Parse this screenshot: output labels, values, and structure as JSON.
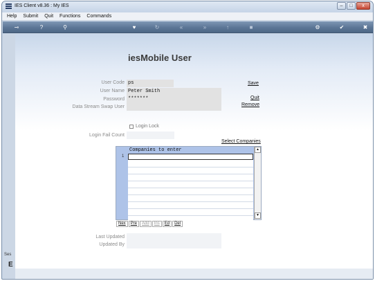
{
  "window": {
    "title": "IES Client v8.36 : My IES",
    "controls": {
      "minimize": "–",
      "maximize": "□",
      "close": "x"
    }
  },
  "menu": [
    "Help",
    "Submit",
    "Quit",
    "Functions",
    "Commands"
  ],
  "toolbar": {
    "icons": [
      "key-icon",
      "help-icon",
      "search-icon",
      "heart-icon",
      "refresh-icon",
      "rewind-icon",
      "fast-forward-icon",
      "up-arrow-icon",
      "stop-icon",
      "gear-icon",
      "check-icon",
      "close-icon"
    ],
    "glyphs": {
      "key": "⊸",
      "help": "?",
      "search": "⚲",
      "heart": "♥",
      "refresh": "↻",
      "rewind": "«",
      "forward": "»",
      "up": "↑",
      "stop": "■",
      "gear": "⚙",
      "check": "✔",
      "close": "✖"
    }
  },
  "form": {
    "heading": "iesMobile User",
    "labels": {
      "user_code": "User Code",
      "user_name": "User Name",
      "password": "Password",
      "swap_user": "Data Stream Swap User",
      "login_lock": "Login Lock",
      "login_fail_count": "Login Fail Count",
      "last_updated": "Last Updated",
      "updated_by": "Updated By"
    },
    "values": {
      "user_code": "ps",
      "user_name": "Peter Smith",
      "password": "*******",
      "swap_user": "",
      "login_fail_count": "",
      "last_updated": "",
      "updated_by": ""
    },
    "login_lock_checked": false
  },
  "actions": {
    "save": "Save",
    "quit": "Quit",
    "remove": "Remove",
    "select_companies": "Select Companies"
  },
  "grid": {
    "header": "Companies to enter",
    "row_number": "1",
    "buttons": {
      "nex": "Nex",
      "pre": "Pre",
      "add": "Add",
      "ins": "Ins",
      "ed": "Ed",
      "del": "Del"
    },
    "scroll_up": "▲",
    "scroll_down": "▼"
  },
  "sidebar": {
    "session_label": "Ses",
    "session_letter": "E"
  },
  "colors": {
    "toolbar": "#5c7696",
    "grid_header": "#aec3e8",
    "field_bg": "#e2e2e2"
  }
}
